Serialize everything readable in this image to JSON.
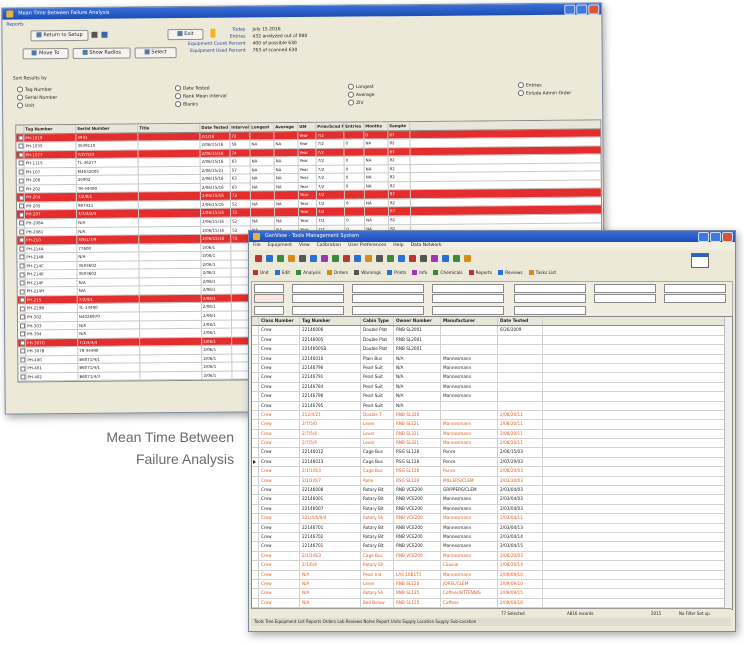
{
  "caption": {
    "line1": "Mean Time Between",
    "line2": "Failure Analysis"
  },
  "win1": {
    "title": "Mean Time Between Failure Analysis",
    "menu_label": "Reports",
    "buttons": {
      "return_setup": "Return to Setup",
      "exit": "Exit",
      "move_to": "Move To",
      "show_radios": "Show Radios",
      "select": "Select"
    },
    "stats": {
      "today_label": "Today",
      "today_value": "July 15 2016",
      "entries_label": "Entries",
      "entries_value": "432 analyzed out of 880",
      "eq_count_label": "Equipment Count Percent",
      "eq_count_value": "400 of possible 630",
      "eq_used_label": "Equipment Used Percent",
      "eq_used_value": "763 of scanned 630"
    },
    "sort_label": "Sort Results by",
    "radios": [
      [
        "Tag Number",
        "Serial Number",
        "Unit"
      ],
      [
        "Date Tested",
        "Rank Mean Interval",
        "Blanks"
      ],
      [
        "Longest",
        "Average",
        "ZIV"
      ],
      [
        "Entries",
        "Exlude Admin Order"
      ]
    ],
    "columns": [
      "Tag Number",
      "Serial Number",
      "Title",
      "Date Tested",
      "Interval",
      "Longest",
      "Average",
      "UM",
      "Prim/Scnd Freq",
      "Entries",
      "Months",
      "Sample"
    ],
    "rows": [
      {
        "red": true,
        "cells": [
          "PH-1019",
          "3931",
          "",
          "2/1/16",
          "72",
          "",
          "",
          "Year",
          "7/2",
          "",
          "0",
          "87"
        ]
      },
      {
        "red": false,
        "cells": [
          "PH-1035",
          "3539110",
          "",
          "2/06/15/16",
          "59",
          "NA",
          "NA",
          "Year",
          "7/2",
          "0",
          "NA",
          "82"
        ]
      },
      {
        "red": true,
        "cells": [
          "PH-1077",
          "7/2/7/23",
          "",
          "2/06/15/16",
          "74",
          "",
          "",
          "Year",
          "7/2",
          "",
          "",
          "87"
        ]
      },
      {
        "red": false,
        "cells": [
          "PH-1115",
          "TL-36277",
          "",
          "2/06/15/16",
          "63",
          "NA",
          "NA",
          "Year",
          "7/2",
          "0",
          "NA",
          "82"
        ]
      },
      {
        "red": false,
        "cells": [
          "PH-107",
          "M4632005",
          "",
          "2/06/15/21",
          "57",
          "NA",
          "NA",
          "Year",
          "7/2",
          "0",
          "NA",
          "82"
        ]
      },
      {
        "red": false,
        "cells": [
          "PH-206",
          "25902",
          "",
          "2/06/15/16",
          "63",
          "NA",
          "NA",
          "Year",
          "7/2",
          "0",
          "NA",
          "82"
        ]
      },
      {
        "red": false,
        "cells": [
          "PH-202",
          "TR-44490",
          "",
          "2/06/15/16",
          "63",
          "NA",
          "NA",
          "Year",
          "7/2",
          "0",
          "NA",
          "82"
        ]
      },
      {
        "red": true,
        "cells": [
          "PH-204",
          "7/2/8/1",
          "",
          "2/06/15/16",
          "72",
          "",
          "",
          "Year",
          "7/2",
          "",
          "",
          "87"
        ]
      },
      {
        "red": false,
        "cells": [
          "PH-205",
          "987411",
          "",
          "2/06/15/16",
          "52",
          "NA",
          "NA",
          "Year",
          "7/2",
          "0",
          "NA",
          "82"
        ]
      },
      {
        "red": true,
        "cells": [
          "PH-207",
          "3/7/2/2/4",
          "",
          "2/06/15/16",
          "72",
          "",
          "",
          "Year",
          "7/2",
          "",
          "",
          "87"
        ]
      },
      {
        "red": false,
        "cells": [
          "PH-208A",
          "N/A",
          "",
          "2/06/15/16",
          "52",
          "NA",
          "NA",
          "Year",
          "7/2",
          "0",
          "NA",
          "82"
        ]
      },
      {
        "red": false,
        "cells": [
          "PH-2081",
          "N/A",
          "",
          "2/06/15/16",
          "52",
          "NA",
          "NA",
          "Year",
          "7/2",
          "0",
          "NA",
          "82"
        ]
      },
      {
        "red": true,
        "cells": [
          "PH-210",
          "3/9/1/7/9",
          "",
          "2/06/15/16",
          "72",
          "",
          "",
          "Year",
          "7/2",
          "",
          "",
          "87"
        ]
      },
      {
        "red": false,
        "cells": [
          "PH-214A",
          "77600",
          "",
          "2/06/1",
          "",
          "",
          "",
          "",
          "",
          "",
          "",
          ""
        ]
      },
      {
        "red": false,
        "cells": [
          "PH-214B",
          "N/A",
          "",
          "2/06/1",
          "",
          "",
          "",
          "",
          "",
          "",
          "",
          ""
        ]
      },
      {
        "red": false,
        "cells": [
          "PH-214C",
          "3503602",
          "",
          "2/06/1",
          "",
          "",
          "",
          "",
          "",
          "",
          "",
          ""
        ]
      },
      {
        "red": false,
        "cells": [
          "PH-214E",
          "3503602",
          "",
          "2/06/1",
          "",
          "",
          "",
          "",
          "",
          "",
          "",
          ""
        ]
      },
      {
        "red": false,
        "cells": [
          "PH-214F",
          "N/A",
          "",
          "2/06/1",
          "",
          "",
          "",
          "",
          "",
          "",
          "",
          ""
        ]
      },
      {
        "red": false,
        "cells": [
          "PH-214H",
          "N/A",
          "",
          "2/06/1",
          "",
          "",
          "",
          "",
          "",
          "",
          "",
          ""
        ]
      },
      {
        "red": true,
        "cells": [
          "PH-215",
          "7/2/4/1",
          "",
          "2/06/1",
          "",
          "",
          "",
          "",
          "",
          "",
          "",
          ""
        ]
      },
      {
        "red": false,
        "cells": [
          "PH-219B",
          "TL-14490",
          "",
          "2/06/1",
          "",
          "",
          "",
          "",
          "",
          "",
          "",
          ""
        ]
      },
      {
        "red": false,
        "cells": [
          "PH-302",
          "N4026970",
          "",
          "2/06/1",
          "",
          "",
          "",
          "",
          "",
          "",
          "",
          ""
        ]
      },
      {
        "red": false,
        "cells": [
          "PH-303",
          "N/A",
          "",
          "2/06/1",
          "",
          "",
          "",
          "",
          "",
          "",
          "",
          ""
        ]
      },
      {
        "red": false,
        "cells": [
          "PH-304",
          "N/A",
          "",
          "2/06/1",
          "",
          "",
          "",
          "",
          "",
          "",
          "",
          ""
        ]
      },
      {
        "red": true,
        "cells": [
          "PH-307G",
          "7/1/4/4/4",
          "",
          "2/06/1",
          "",
          "",
          "",
          "",
          "",
          "",
          "",
          ""
        ]
      },
      {
        "red": false,
        "cells": [
          "PH-307B",
          "TR-44490",
          "",
          "2/06/1",
          "",
          "",
          "",
          "",
          "",
          "",
          "",
          ""
        ]
      },
      {
        "red": false,
        "cells": [
          "PH-400",
          "B6071/4/1",
          "",
          "2/06/1",
          "",
          "",
          "",
          "",
          "",
          "",
          "",
          ""
        ]
      },
      {
        "red": false,
        "cells": [
          "PH-401",
          "B6071/4/1",
          "",
          "2/06/1",
          "",
          "",
          "",
          "",
          "",
          "",
          "",
          ""
        ]
      },
      {
        "red": false,
        "cells": [
          "PH-402",
          "B6071/4/3",
          "",
          "2/06/1",
          "",
          "",
          "",
          "",
          "",
          "",
          "",
          ""
        ]
      }
    ]
  },
  "win2": {
    "title": "GenView - Tools Management System",
    "menu": [
      "File",
      "Equipment",
      "View",
      "Calibration",
      "User Preferences",
      "Help",
      "Data Network"
    ],
    "toolbar2": [
      "Unit",
      "Edit",
      "Analysis",
      "Orders",
      "Warnings",
      "Prints",
      "Info",
      "Chemicals",
      "Reports",
      "Reviews",
      "Tasks List"
    ],
    "columns": [
      "Class Number",
      "Tag Number",
      "Cabin Type",
      "Owner Number",
      "Manufacturer",
      "Date Tested"
    ],
    "rows": [
      {
        "orange": false,
        "sel": false,
        "cells": [
          "Crew",
          "22146006",
          "Double Plat",
          "RNB SL2001",
          "",
          "6/26/2009"
        ]
      },
      {
        "orange": false,
        "sel": false,
        "cells": [
          "Crew",
          "22146005",
          "Double Plat",
          "RNB SL2001",
          "",
          ""
        ]
      },
      {
        "orange": false,
        "sel": false,
        "cells": [
          "Crew",
          "22146005B",
          "Double Plat",
          "RNB SL2001",
          "",
          ""
        ]
      },
      {
        "orange": false,
        "sel": false,
        "cells": [
          "Crew",
          "22146016",
          "Plain Bus",
          "N/A",
          "Mannesmann",
          ""
        ]
      },
      {
        "orange": false,
        "sel": false,
        "cells": [
          "Crew",
          "22146796",
          "Pearl Suit",
          "N/A",
          "Mannesmann",
          ""
        ]
      },
      {
        "orange": false,
        "sel": false,
        "cells": [
          "Crew",
          "22146791",
          "Pearl Suit",
          "N/A",
          "Mannesmann",
          ""
        ]
      },
      {
        "orange": false,
        "sel": false,
        "cells": [
          "Crew",
          "22146784",
          "Pearl Suit",
          "N/A",
          "Mannesmann",
          ""
        ]
      },
      {
        "orange": false,
        "sel": false,
        "cells": [
          "Crew",
          "22146796",
          "Pearl Suit",
          "N/A",
          "Mannesmann",
          ""
        ]
      },
      {
        "orange": false,
        "sel": false,
        "cells": [
          "Crew",
          "22146795",
          "Pearl Suit",
          "N/A",
          "",
          ""
        ]
      },
      {
        "orange": true,
        "sel": false,
        "cells": [
          "Crew",
          "212/4/21",
          "Double T",
          "RNB SL320",
          "",
          "2/08/20/11"
        ]
      },
      {
        "orange": true,
        "sel": false,
        "cells": [
          "Crew",
          "2/7/5/0",
          "Lever",
          "RNB SL12L",
          "Mannesmann",
          "2/08/20/11"
        ]
      },
      {
        "orange": true,
        "sel": false,
        "cells": [
          "Crew",
          "2/7/5/4",
          "Lever",
          "RNB SL32L",
          "Mannesmann",
          "2/08/20/11"
        ]
      },
      {
        "orange": true,
        "sel": false,
        "cells": [
          "Crew",
          "2/7/5/9",
          "Lever",
          "RNB SL32L",
          "Mannesmann",
          "2/08/20/11"
        ]
      },
      {
        "orange": false,
        "sel": false,
        "cells": [
          "Crew",
          "22146012",
          "Cage Bus",
          "RSG SL128",
          "Ponce",
          "2/06/15/03"
        ]
      },
      {
        "orange": false,
        "sel": true,
        "cells": [
          "Crew",
          "22146013",
          "Cage Bus",
          "RSG SL128",
          "Ponce",
          "2/07/29/03"
        ]
      },
      {
        "orange": true,
        "sel": false,
        "cells": [
          "Crew",
          "2/1/1/6/3",
          "Cage Bus",
          "RSG SL128",
          "Ponce",
          "2/08/20/03"
        ]
      },
      {
        "orange": true,
        "sel": false,
        "cells": [
          "Crew",
          "2/1/1/6/7",
          "Rollo",
          "RSG SL128",
          "MILLERS/CLEM",
          "2/03/20/03"
        ]
      },
      {
        "orange": false,
        "sel": false,
        "cells": [
          "Crew",
          "22146008",
          "Rotary Bit",
          "RNB VCE200",
          "GRIPPERS/CLEM",
          "2/03/04/03"
        ]
      },
      {
        "orange": false,
        "sel": false,
        "cells": [
          "Crew",
          "22146001",
          "Rotary Bit",
          "RNB VCE200",
          "Mannesmann",
          "2/03/04/03"
        ]
      },
      {
        "orange": false,
        "sel": false,
        "cells": [
          "Crew",
          "22146007",
          "Rotary Bit",
          "RNB VCE200",
          "Mannesmann",
          "2/03/04/03"
        ]
      },
      {
        "orange": true,
        "sel": false,
        "cells": [
          "Crew",
          "221/4/6/9/4",
          "Rotary Sh",
          "RNB VCE200",
          "Mannesmann",
          "2/03/04/11"
        ]
      },
      {
        "orange": false,
        "sel": false,
        "cells": [
          "Crew",
          "22146701",
          "Rotary Bit",
          "RNB VCE200",
          "Mannesmann",
          "2/03/04/13"
        ]
      },
      {
        "orange": false,
        "sel": false,
        "cells": [
          "Crew",
          "22146702",
          "Rotary Bit",
          "RNB VCE200",
          "Mannesmann",
          "2/03/04/14"
        ]
      },
      {
        "orange": false,
        "sel": false,
        "cells": [
          "Crew",
          "22146701",
          "Rotary Bit",
          "RNB VCE200",
          "Mannesmann",
          "2/03/04/15"
        ]
      },
      {
        "orange": true,
        "sel": false,
        "cells": [
          "Crew",
          "2/1/1/6/3",
          "Cage Bus",
          "RNB VCE200",
          "Mannesmann",
          "2/08/20/03"
        ]
      },
      {
        "orange": true,
        "sel": false,
        "cells": [
          "Crew",
          "2/1/6/4",
          "Rotary Sh",
          "",
          "Coaxial",
          "2/08/20/14"
        ]
      },
      {
        "orange": true,
        "sel": false,
        "cells": [
          "Crew",
          "N/A",
          "Pearl Ind",
          "LAS 16B1T1",
          "Mannesmann",
          "2/09/09/10"
        ]
      },
      {
        "orange": true,
        "sel": false,
        "cells": [
          "Crew",
          "N/A",
          "Lever",
          "RNB SL120",
          "JOREL/CLEM",
          "2/09/09/10"
        ]
      },
      {
        "orange": true,
        "sel": false,
        "cells": [
          "Crew",
          "N/A",
          "Rotary Sh",
          "RNB SL125",
          "Coffees/BTTENNIS",
          "2/09/09/15"
        ]
      },
      {
        "orange": true,
        "sel": false,
        "cells": [
          "Crew",
          "N/A",
          "Bell Below",
          "RNB SL125",
          "Coffees",
          "2/09/09/16"
        ]
      }
    ],
    "status": {
      "s1": "77 Selected",
      "s2": "A816 records",
      "s3": "2015",
      "s4": "No Filter Set up"
    },
    "tabs": "Tools Tree  Equipment List  Reports  Orders  Lab Reviews  Notes  Report Units  Supply Location  Supply Sub-Location"
  }
}
